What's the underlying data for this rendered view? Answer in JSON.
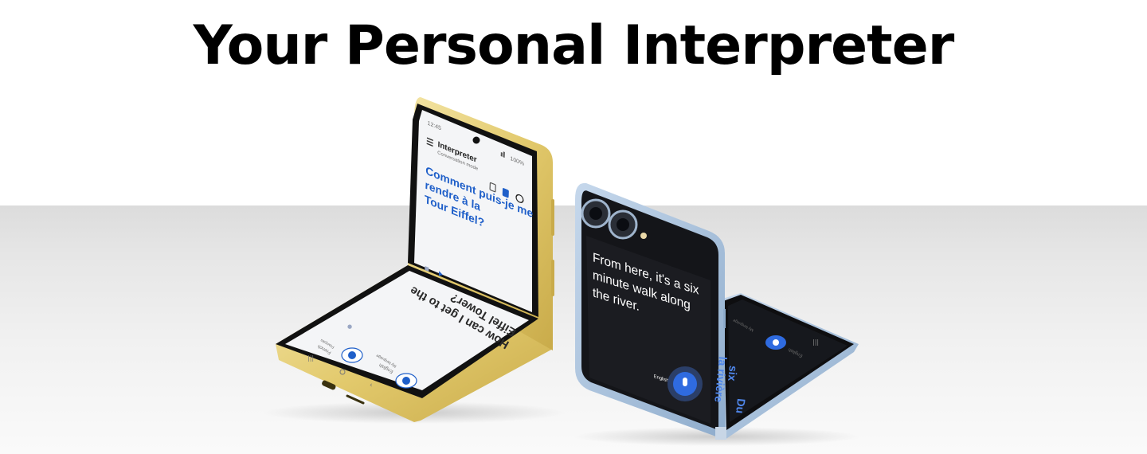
{
  "headline": "Your Personal Interpreter",
  "yellow_phone": {
    "status_time": "12:45",
    "status_battery": "100%",
    "app_title": "Interpreter",
    "app_subtitle": "Conversation mode",
    "french_lines": [
      "Comment puis-je me",
      "rendre à la",
      "Tour Eiffel?"
    ],
    "english_lines": [
      "How can I get to the",
      "Eiffel Tower?"
    ],
    "lang_left": "French",
    "lang_left_sub": "Français",
    "lang_right": "English",
    "lang_right_sub": "My language",
    "icons": {
      "menu": "menu-icon",
      "signal": "signal-icon",
      "layout": "layout-icon",
      "history": "history-icon",
      "speaker": "speaker-icon",
      "mic": "mic-icon"
    }
  },
  "blue_phone": {
    "cover_lines": [
      "From here, it's a six",
      "minute walk along",
      "the river."
    ],
    "cover_lang": "English",
    "inner_lang": "English",
    "inner_lang_sub": "My language",
    "inner_lines": [
      "Du",
      "six",
      "la rivière"
    ],
    "icons": {
      "mic": "mic-icon",
      "camera": "camera-icon"
    }
  },
  "colors": {
    "yellow_frame": "#e8d27a",
    "blue_frame": "#a9c3de",
    "accent_blue": "#1f5fc9"
  }
}
